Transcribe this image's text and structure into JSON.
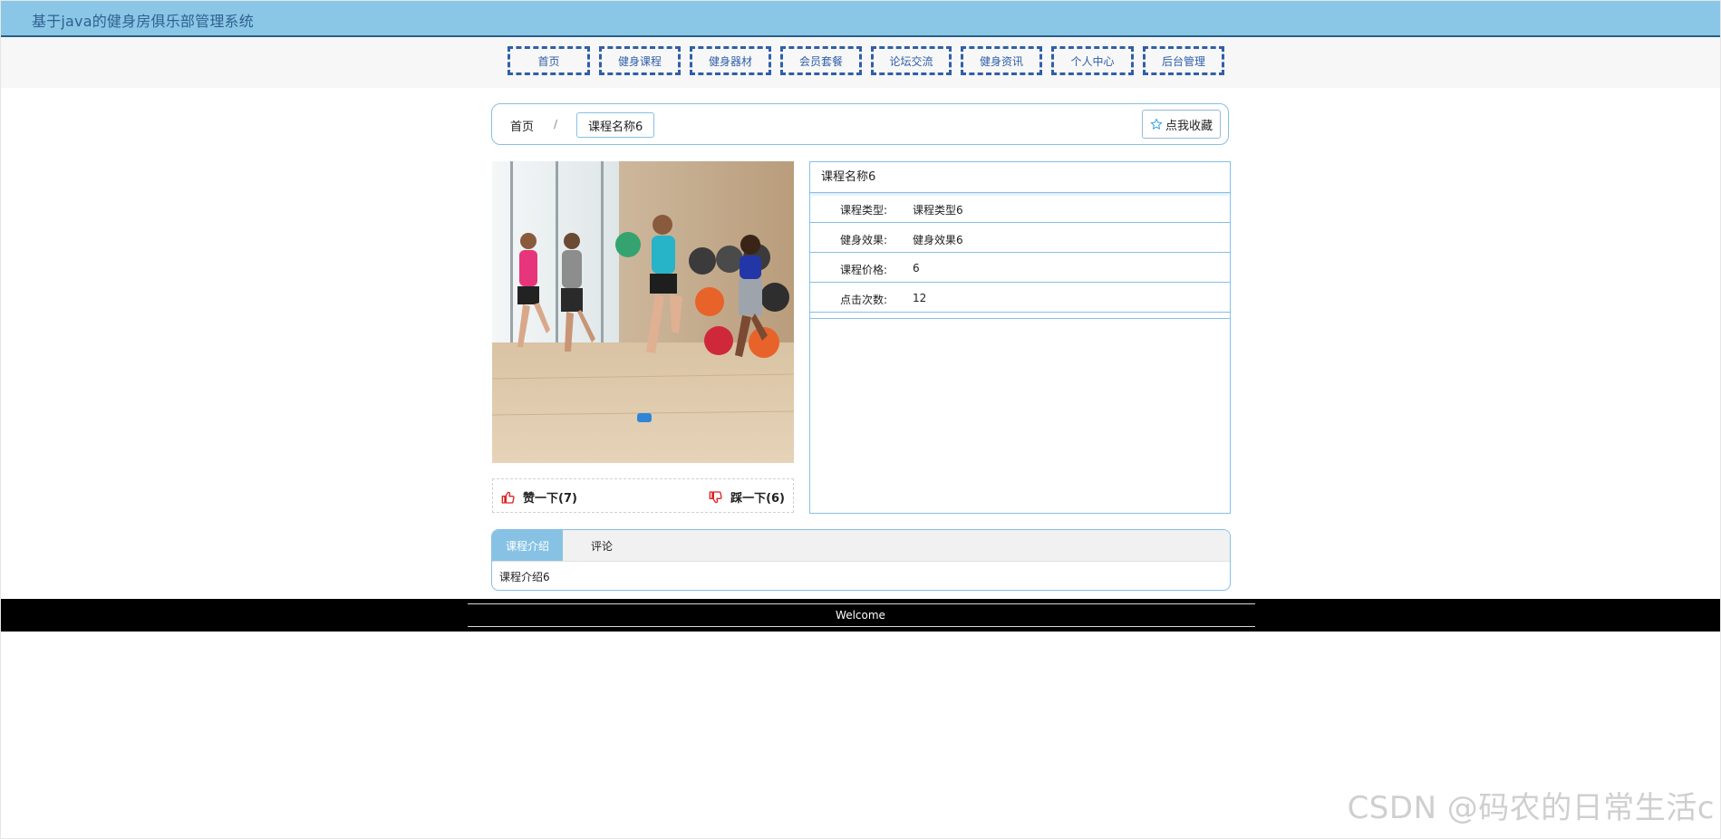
{
  "header": {
    "site_title": "基于java的健身房俱乐部管理系统"
  },
  "nav": {
    "items": [
      {
        "label": "首页"
      },
      {
        "label": "健身课程"
      },
      {
        "label": "健身器材"
      },
      {
        "label": "会员套餐"
      },
      {
        "label": "论坛交流"
      },
      {
        "label": "健身资讯"
      },
      {
        "label": "个人中心"
      },
      {
        "label": "后台管理"
      }
    ]
  },
  "breadcrumb": {
    "home": "首页",
    "separator": "/",
    "current": "课程名称6",
    "favorite_label": "点我收藏",
    "favorite_icon": "star-icon"
  },
  "course": {
    "name": "课程名称6",
    "fields": [
      {
        "label": "课程类型:",
        "value": "课程类型6"
      },
      {
        "label": "健身效果:",
        "value": "健身效果6"
      },
      {
        "label": "课程价格:",
        "value": "6"
      },
      {
        "label": "点击次数:",
        "value": "12"
      }
    ]
  },
  "votes": {
    "like_label": "赞一下(7)",
    "dislike_label": "踩一下(6)",
    "like_icon": "thumbs-up-icon",
    "dislike_icon": "thumbs-down-icon",
    "icon_color": "#e02020"
  },
  "tabs": {
    "items": [
      {
        "label": "课程介绍",
        "active": true
      },
      {
        "label": "评论",
        "active": false
      }
    ],
    "content": "课程介绍6"
  },
  "footer": {
    "text": "Welcome"
  },
  "watermark": {
    "text": "CSDN @码农的日常生活c"
  },
  "colors": {
    "header_bg": "#8ac7e7",
    "accent": "#86c0e6",
    "nav_border": "#2f5fa8",
    "footer_bg": "#000000"
  }
}
